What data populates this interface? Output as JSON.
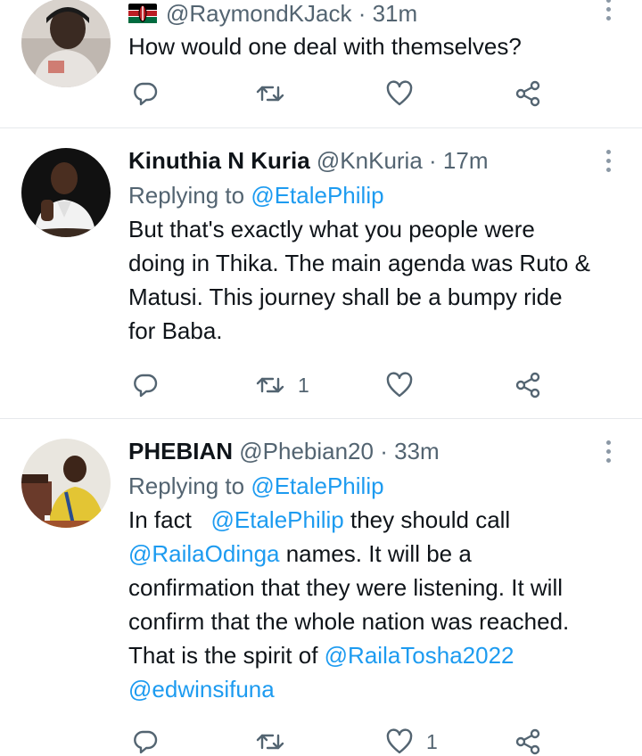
{
  "tweets": [
    {
      "display_name": "",
      "handle": "@RaymondKJack",
      "time": "· 31m",
      "replying_prefix": "",
      "replying_to": "",
      "lines": [
        "How would one deal with themselves?"
      ],
      "actions": {
        "replies": "",
        "retweets": "",
        "likes": ""
      }
    },
    {
      "display_name": "Kinuthia N Kuria",
      "handle": "@KnKuria",
      "time": "· 17m",
      "replying_prefix": "Replying to",
      "replying_to": "@EtalePhilip",
      "lines": [
        "But that's exactly what you people were",
        "doing in Thika. The main agenda was Ruto &",
        "Matusi. This journey shall be a bumpy ride",
        "for Baba."
      ],
      "actions": {
        "replies": "",
        "retweets": "1",
        "likes": ""
      }
    },
    {
      "display_name": "PHEBIAN",
      "handle": "@Phebian20",
      "time": "· 33m",
      "replying_prefix": "Replying to",
      "replying_to": "@EtalePhilip",
      "line1_pre": "In fact",
      "line1_mention": "@EtalePhilip",
      "line1_post": "they should call",
      "line2_mention": "@RailaOdinga",
      "line2_post": "names. It will be a",
      "line3": "confirmation that they were listening. It will",
      "line4": "confirm that the whole nation was reached.",
      "line5_pre": "That is the spirit of",
      "line5_mention": "@RailaTosha2022",
      "line6_mention": "@edwinsifuna",
      "actions": {
        "replies": "",
        "retweets": "",
        "likes": "1"
      }
    }
  ],
  "icons": {
    "reply": "reply-icon",
    "retweet": "retweet-icon",
    "like": "like-icon",
    "share": "share-icon",
    "more": "more-icon",
    "flag": "kenya-flag-icon"
  },
  "colors": {
    "link": "#1d9bf0",
    "secondary": "#536471",
    "text": "#0f1419",
    "divider": "#e6e9ec"
  }
}
